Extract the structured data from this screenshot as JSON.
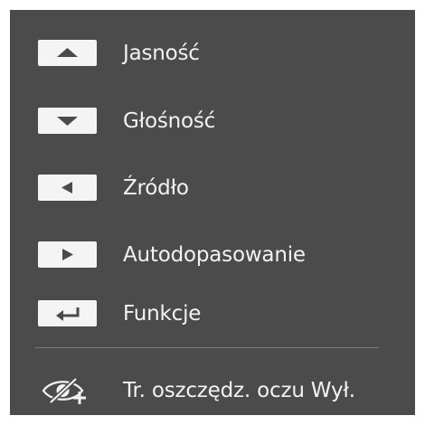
{
  "menu": {
    "items": [
      {
        "label": "Jasność",
        "icon": "arrow-up-icon"
      },
      {
        "label": "Głośność",
        "icon": "arrow-down-icon"
      },
      {
        "label": "Źródło",
        "icon": "arrow-left-icon"
      },
      {
        "label": "Autodopasowanie",
        "icon": "arrow-right-icon"
      },
      {
        "label": "Funkcje",
        "icon": "enter-icon"
      }
    ],
    "eye_saver": {
      "label": "Tr. oszczędz. oczu Wył.",
      "icon": "eye-saver-icon"
    }
  },
  "colors": {
    "panel_background": "#4b4b4b",
    "text": "#f2f2f2",
    "key_badge": "#f4f4f4",
    "key_glyph": "#4b4b4b",
    "divider": "#7a7a7a"
  }
}
